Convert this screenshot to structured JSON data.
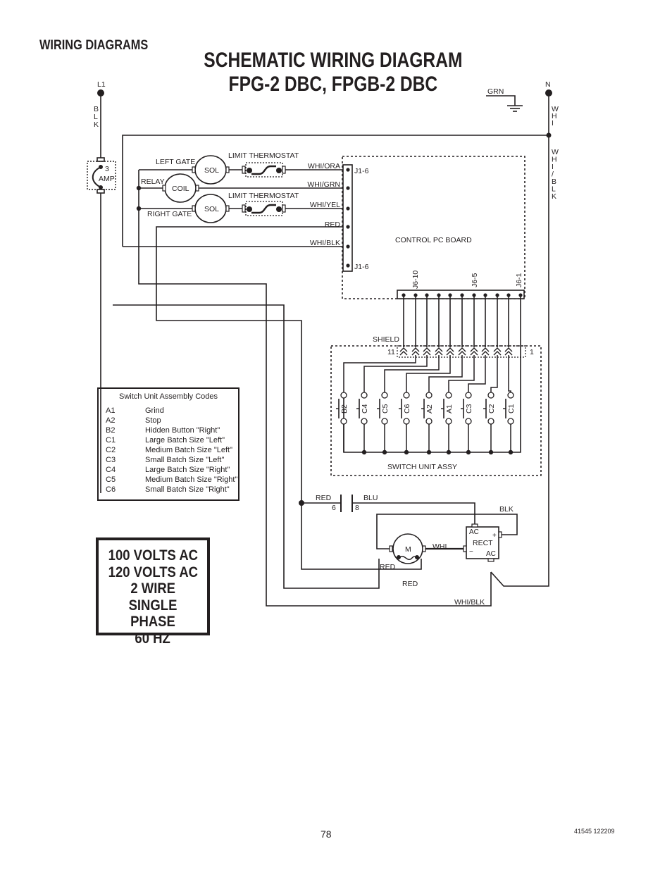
{
  "header": {
    "section_title": "WIRING DIAGRAMS",
    "title_line1": "SCHEMATIC WIRING DIAGRAM",
    "title_line2": "FPG-2 DBC, FPGB-2 DBC"
  },
  "power": {
    "line_label": "L1",
    "line_wire": "BLK",
    "neutral_label": "N",
    "neutral_wire_top": "WHI",
    "neutral_wire_bottom": "WHI/BLK",
    "ground_label": "GRN",
    "fuse_value": "3",
    "fuse_unit": "AMP"
  },
  "components": {
    "left_gate": "LEFT GATE",
    "right_gate": "RIGHT GATE",
    "relay": "RELAY",
    "coil": "COIL",
    "solenoid": "SOL",
    "limit_thermostat": "LIMIT THERMOSTAT",
    "control_board": "CONTROL PC BOARD",
    "switch_unit": "SWITCH UNIT ASSY",
    "shield": "SHIELD",
    "motor": "M",
    "rectifier": "RECT",
    "rect_ac": "AC",
    "rect_plus": "+",
    "rect_minus": "−"
  },
  "connector_j1": {
    "top_label": "J1-6",
    "bottom_label": "J1-6",
    "wires": [
      "WHI/ORA",
      "WHI/GRN",
      "WHI/YEL",
      "RED",
      "WHI/BLK"
    ]
  },
  "connector_j6": {
    "labels": [
      "J6-10",
      "J6-5",
      "J6-1"
    ],
    "pin_count": 11,
    "shield_pin_left": "11",
    "shield_pin_right": "1"
  },
  "switches": [
    "B2",
    "C4",
    "C5",
    "C6",
    "A2",
    "A1",
    "C3",
    "C2",
    "C1"
  ],
  "motor_circuit": {
    "contact_left_wire": "RED",
    "contact_left_pin": "6",
    "contact_right_wire": "BLU",
    "contact_right_pin": "8",
    "blk_wire": "BLK",
    "whi_wire": "WHI",
    "red_wire_1": "RED",
    "red_wire_2": "RED",
    "whi_blk_wire": "WHI/BLK"
  },
  "codes_table": {
    "title": "Switch Unit Assembly Codes",
    "rows": [
      {
        "code": "A1",
        "desc": "Grind"
      },
      {
        "code": "A2",
        "desc": "Stop"
      },
      {
        "code": "B2",
        "desc": "Hidden Button \"Right\""
      },
      {
        "code": "C1",
        "desc": "Large Batch Size \"Left\""
      },
      {
        "code": "C2",
        "desc": "Medium Batch Size \"Left\""
      },
      {
        "code": "C3",
        "desc": "Small Batch Size \"Left\""
      },
      {
        "code": "C4",
        "desc": "Large Batch Size \"Right\""
      },
      {
        "code": "C5",
        "desc": "Medium Batch Size \"Right\""
      },
      {
        "code": "C6",
        "desc": "Small Batch Size \"Right\""
      }
    ]
  },
  "power_spec": [
    "100 VOLTS AC",
    "120 VOLTS AC",
    "2 WIRE",
    "SINGLE PHASE",
    "60 HZ"
  ],
  "footer": {
    "page_number": "78",
    "doc_code": "41545 122209"
  }
}
